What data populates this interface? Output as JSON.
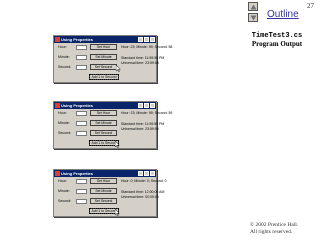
{
  "slide": {
    "number": "27",
    "outline_label": "Outline",
    "subtitle_code": "TimeTest3.cs",
    "subtitle_text": "Program Output",
    "copyright_line1": "© 2002 Prentice Hall.",
    "copyright_line2": "All rights reserved."
  },
  "icons": {
    "nav_up": "triangle-up-icon",
    "nav_down": "triangle-down-icon",
    "cursor": "mouse-pointer-icon"
  },
  "colors": {
    "titlebar": "#0a246a",
    "window_face": "#d4d0c8",
    "outline_link": "#333399"
  },
  "windows": [
    {
      "title": "Using Properties",
      "hour_label": "Hour:",
      "minute_label": "Minute:",
      "second_label": "Second:",
      "set_hour": "Set Hour",
      "set_minute": "Set Minute",
      "set_second": "Set Second",
      "add_second": "Add 1 to Second",
      "hms": "Hour: 23; Minute: 59; Second: 58",
      "standard": "Standard time: 11:59:58 PM",
      "universal": "Universal time: 23:59:58"
    },
    {
      "title": "Using Properties",
      "hour_label": "Hour:",
      "minute_label": "Minute:",
      "second_label": "Second:",
      "set_hour": "Set Hour",
      "set_minute": "Set Minute",
      "set_second": "Set Second",
      "add_second": "Add 1 to Second",
      "hms": "Hour: 23; Minute: 59; Second: 59",
      "standard": "Standard time: 11:59:59 PM",
      "universal": "Universal time: 23:59:59"
    },
    {
      "title": "Using Properties",
      "hour_label": "Hour:",
      "minute_label": "Minute:",
      "second_label": "Second:",
      "set_hour": "Set Hour",
      "set_minute": "Set Minute",
      "set_second": "Set Second",
      "add_second": "Add 1 to Second",
      "hms": "Hour: 0; Minute: 0; Second: 0",
      "standard": "Standard time: 12:00:00 AM",
      "universal": "Universal time: 00:00:00"
    }
  ]
}
